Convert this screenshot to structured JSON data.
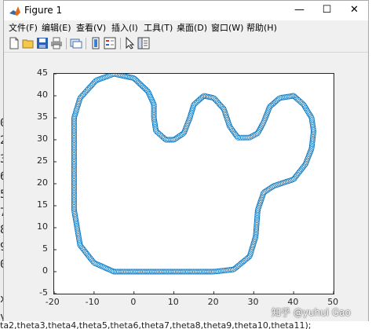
{
  "window": {
    "title": "Figure 1",
    "minimize": "—",
    "maximize": "☐",
    "close": "✕"
  },
  "menu": [
    "文件(F)",
    "编辑(E)",
    "查看(V)",
    "插入(I)",
    "工具(T)",
    "桌面(D)",
    "窗口(W)",
    "帮助(H)"
  ],
  "toolbar_icons": [
    "new-figure-icon",
    "open-file-icon",
    "save-icon",
    "print-icon",
    "link-plot-icon",
    "colorbar-icon",
    "legend-icon",
    "pointer-icon",
    "property-inspector-icon"
  ],
  "background_text": {
    "left_chars": [
      "0",
      "2",
      "3",
      "6",
      "5",
      "7",
      "8",
      "9",
      "0",
      "x",
      "y"
    ],
    "bottom_line": "ta2,theta3,theta4,theta5,theta6,theta7,theta8,theta9,theta10,theta11);"
  },
  "watermark": "知乎 @yuhui Gao",
  "colors": {
    "marker": "#0072bd",
    "axes_bg": "#ffffff",
    "figure_bg": "#f0f0f0"
  },
  "chart_data": {
    "type": "scatter",
    "marker": "o",
    "xlim": [
      -20,
      50
    ],
    "ylim": [
      -5,
      45
    ],
    "xticks": [
      "-20",
      "-10",
      "0",
      "10",
      "20",
      "30",
      "40",
      "50"
    ],
    "yticks": [
      "-5",
      "0",
      "5",
      "10",
      "15",
      "20",
      "25",
      "30",
      "35",
      "40",
      "45"
    ],
    "path_vertices": [
      [
        40,
        40
      ],
      [
        42.5,
        38
      ],
      [
        44.5,
        35
      ],
      [
        45,
        32
      ],
      [
        44.5,
        28
      ],
      [
        43,
        24.5
      ],
      [
        40,
        21
      ],
      [
        35,
        19.5
      ],
      [
        32.5,
        18
      ],
      [
        31,
        14
      ],
      [
        30.5,
        8
      ],
      [
        29,
        3.5
      ],
      [
        25,
        0.5
      ],
      [
        20,
        0
      ],
      [
        10,
        0
      ],
      [
        0,
        0
      ],
      [
        -5,
        0
      ],
      [
        -10,
        2
      ],
      [
        -13.5,
        6
      ],
      [
        -15,
        14
      ],
      [
        -15,
        25
      ],
      [
        -15,
        35
      ],
      [
        -13.5,
        39.5
      ],
      [
        -9.5,
        43.5
      ],
      [
        -5,
        45
      ],
      [
        0,
        44
      ],
      [
        3.5,
        41
      ],
      [
        5,
        38
      ],
      [
        5,
        35
      ],
      [
        5.5,
        32
      ],
      [
        8,
        30
      ],
      [
        10,
        30
      ],
      [
        12.5,
        31.5
      ],
      [
        14,
        35
      ],
      [
        15,
        38
      ],
      [
        17.5,
        40
      ],
      [
        20,
        39.5
      ],
      [
        22.5,
        37
      ],
      [
        24,
        33
      ],
      [
        26,
        30.5
      ],
      [
        29,
        30.5
      ],
      [
        31,
        31.5
      ],
      [
        32.5,
        34
      ],
      [
        34,
        37.5
      ],
      [
        36.5,
        39.5
      ],
      [
        40,
        40
      ]
    ]
  }
}
